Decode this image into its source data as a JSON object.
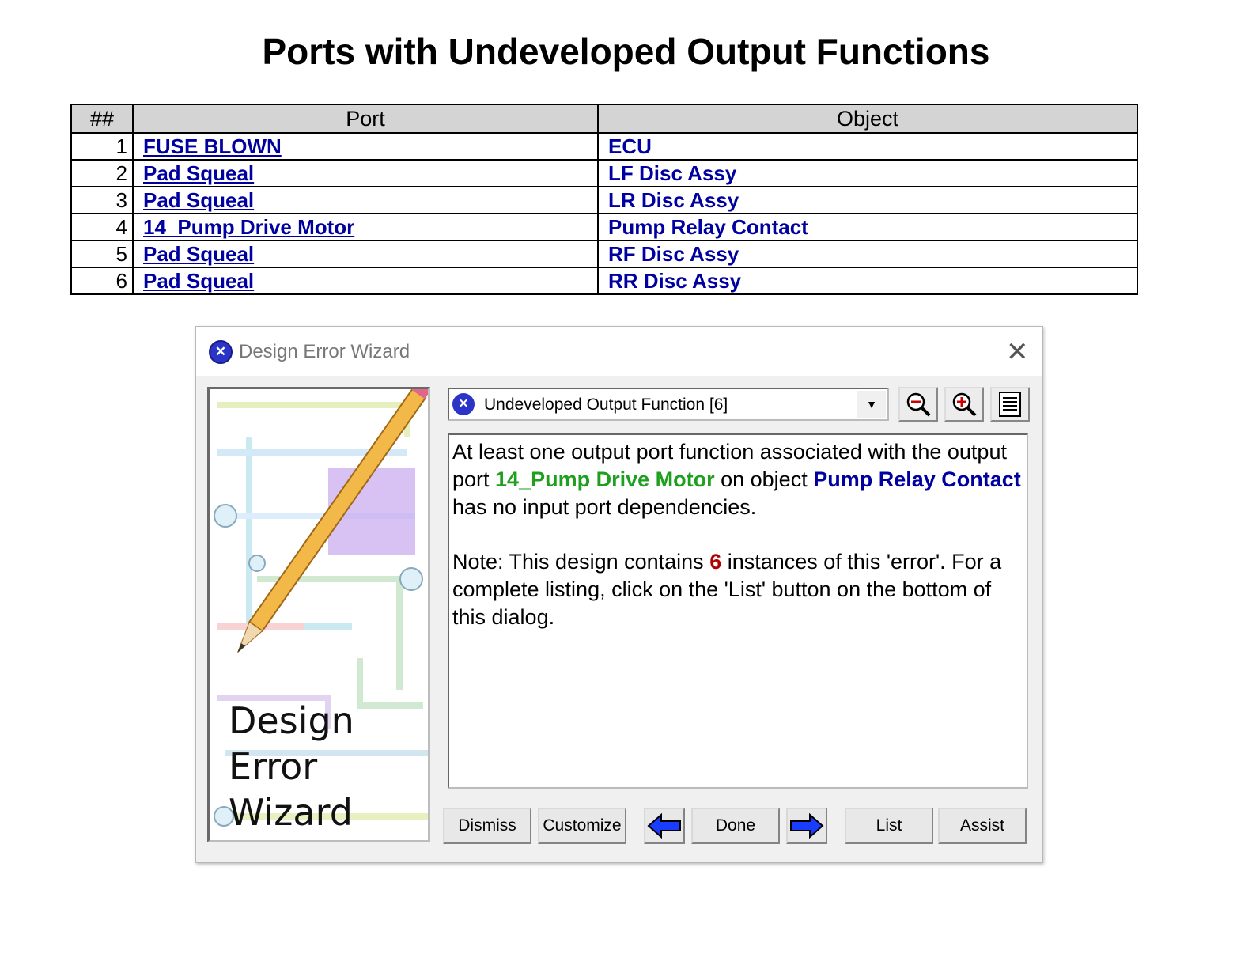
{
  "page": {
    "title": "Ports with Undeveloped Output Functions"
  },
  "table": {
    "headers": [
      "##",
      "Port",
      "Object"
    ],
    "rows": [
      {
        "num": "1",
        "port": "FUSE BLOWN",
        "object": "ECU"
      },
      {
        "num": "2",
        "port": "Pad Squeal",
        "object": "LF Disc Assy"
      },
      {
        "num": "3",
        "port": "Pad Squeal",
        "object": "LR Disc Assy"
      },
      {
        "num": "4",
        "port": "14_Pump Drive Motor",
        "object": "Pump Relay Contact"
      },
      {
        "num": "5",
        "port": "Pad Squeal",
        "object": "RF Disc Assy"
      },
      {
        "num": "6",
        "port": "Pad Squeal",
        "object": "RR Disc Assy"
      }
    ]
  },
  "dialog": {
    "title": "Design Error Wizard",
    "side_text": [
      "Design",
      "Error",
      "Wizard"
    ],
    "error_type": "Undeveloped Output Function [6]",
    "message": {
      "p1_a": "At least one output port function associated with the output port ",
      "p1_port": "14_Pump Drive Motor",
      "p1_b": " on object ",
      "p1_object": "Pump Relay Contact",
      "p1_c": " has no input port dependencies.",
      "p2_a": "Note: This design contains ",
      "p2_count": "6",
      "p2_b": " instances of this 'error'. For a complete listing, click on the 'List' button on the bottom of this dialog."
    },
    "buttons": {
      "dismiss": "Dismiss",
      "customize": "Customize",
      "done": "Done",
      "list": "List",
      "assist": "Assist"
    },
    "icons": [
      "close-icon",
      "zoom-out-icon",
      "zoom-in-icon",
      "list-icon",
      "arrow-left-icon",
      "arrow-right-icon"
    ]
  }
}
